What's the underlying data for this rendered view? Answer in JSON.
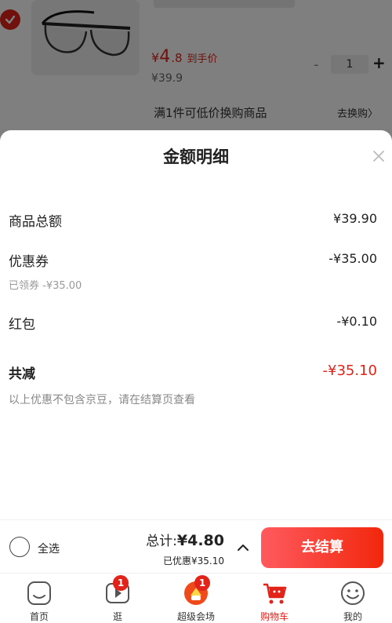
{
  "cart_item": {
    "price_currency": "¥",
    "price_int": "4",
    "price_dec": ".8",
    "price_tag": "到手价",
    "original_price": "¥39.9",
    "quantity": "1",
    "minus": "-",
    "plus": "+",
    "promo_text": "满1件可低价换购商品",
    "swap_link": "去换购〉"
  },
  "sheet": {
    "title": "金额明细",
    "rows": [
      {
        "label": "商品总额",
        "value": "¥39.90"
      },
      {
        "label": "优惠券",
        "value": "-¥35.00",
        "sub": "已领券 -¥35.00"
      },
      {
        "label": "红包",
        "value": "-¥0.10"
      },
      {
        "label": "共减",
        "value": "-¥35.10"
      }
    ],
    "note": "以上优惠不包含京豆，请在结算页查看"
  },
  "settle": {
    "select_all": "全选",
    "total_label": "总计:",
    "total_amount": "¥4.80",
    "saved": "已优惠¥35.10",
    "checkout": "去结算"
  },
  "tabs": [
    {
      "label": "首页",
      "icon": "home-icon"
    },
    {
      "label": "逛",
      "icon": "video-icon",
      "badge": "1"
    },
    {
      "label": "超级会场",
      "icon": "promo-hall-icon",
      "badge": "1"
    },
    {
      "label": "购物车",
      "icon": "cart-icon",
      "active": true
    },
    {
      "label": "我的",
      "icon": "profile-icon"
    }
  ],
  "colors": {
    "accent": "#e2231a",
    "overlay": "rgba(0,0,0,0.5)"
  }
}
